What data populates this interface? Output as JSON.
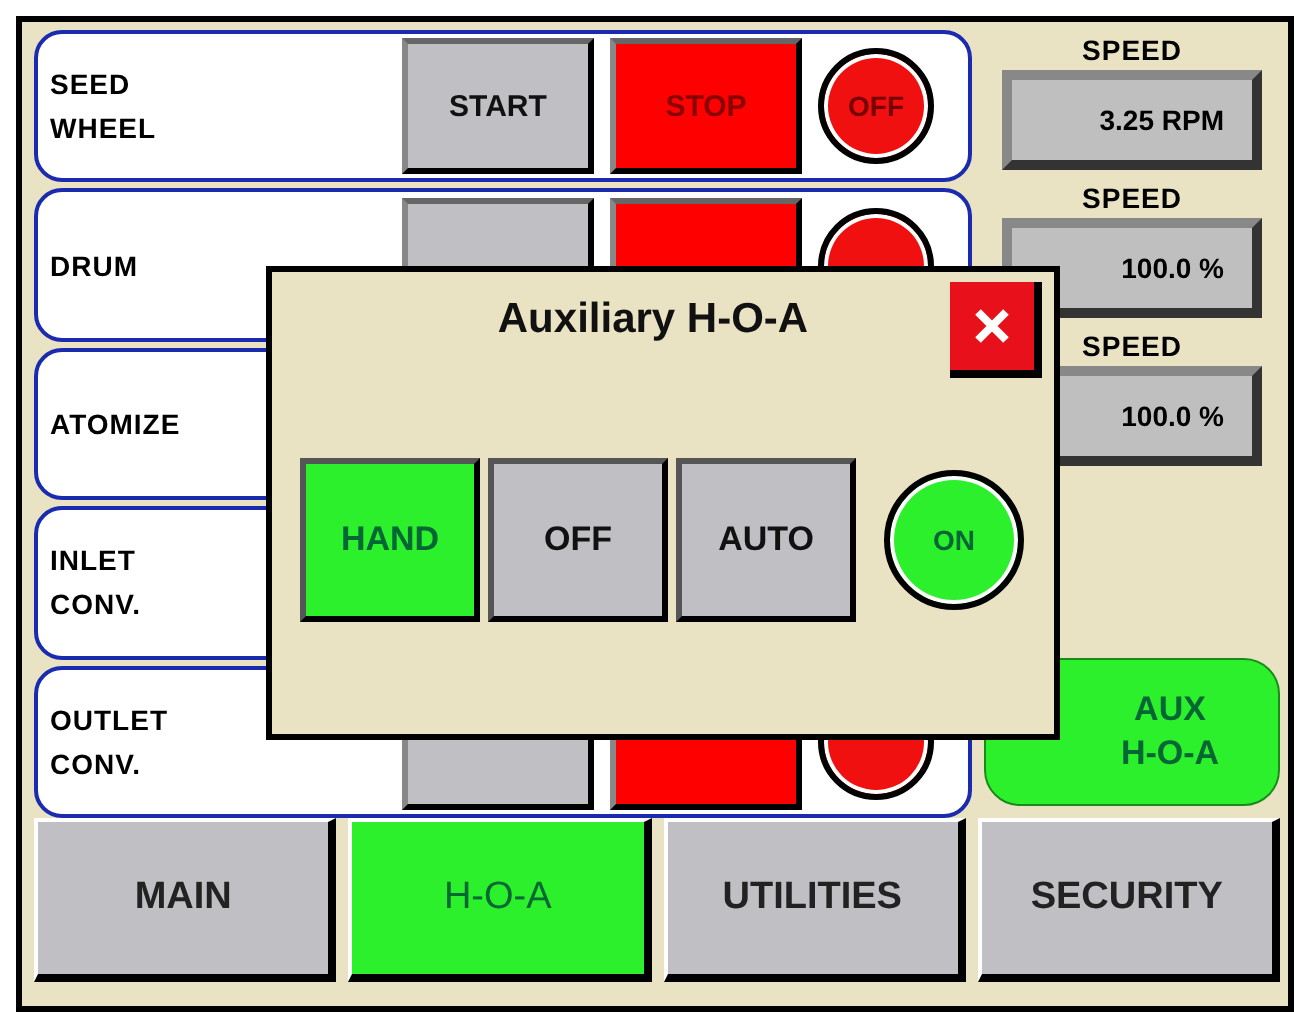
{
  "rows": [
    {
      "label": "SEED WHEEL",
      "start": "START",
      "stop": "STOP",
      "indicator": {
        "text": "OFF",
        "on": false
      }
    },
    {
      "label": "DRUM",
      "indicator": {
        "on": false
      }
    },
    {
      "label": "ATOMIZE"
    },
    {
      "label": "INLET CONV."
    },
    {
      "label": "OUTLET CONV.",
      "indicator": {
        "on": false
      }
    }
  ],
  "readouts": [
    {
      "label": "SPEED",
      "value": "3.25 RPM"
    },
    {
      "label": "SPEED",
      "value": "100.0 %"
    },
    {
      "label": "SPEED",
      "value": "100.0 %"
    }
  ],
  "aux_button": {
    "label": "AUX H-O-A"
  },
  "tabs": [
    {
      "label": "MAIN",
      "selected": false
    },
    {
      "label": "H-O-A",
      "selected": true
    },
    {
      "label": "UTILITIES",
      "selected": false
    },
    {
      "label": "SECURITY",
      "selected": false
    }
  ],
  "dialog": {
    "title": "Auxiliary H-O-A",
    "modes": [
      {
        "label": "HAND",
        "selected": true
      },
      {
        "label": "OFF",
        "selected": false
      },
      {
        "label": "AUTO",
        "selected": false
      }
    ],
    "indicator": {
      "text": "ON",
      "on": true
    }
  }
}
